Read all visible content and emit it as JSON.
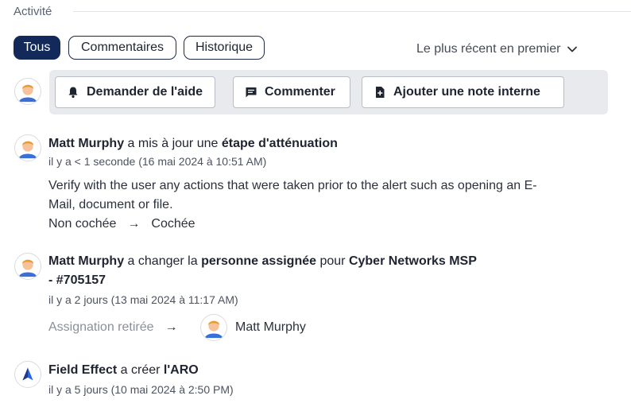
{
  "section": {
    "title": "Activité"
  },
  "filters": {
    "all": "Tous",
    "comments": "Commentaires",
    "history": "Historique"
  },
  "sort": {
    "label": "Le plus récent en premier",
    "icon": "chevron-down-icon"
  },
  "actions": {
    "help": "Demander de l'aide",
    "comment": "Commenter",
    "note": "Ajouter une note interne"
  },
  "entries": [
    {
      "actor": "Matt Murphy",
      "verb": " a mis à jour une ",
      "object": "étape d'atténuation",
      "time": "il y a < 1 seconde (16 mai 2024 à 10:51 AM)",
      "body_line1": "Verify with the user any actions that were taken prior to the alert such as opening an E-",
      "body_line2": "Mail, document or file.",
      "from": "Non cochée",
      "arrow": "→",
      "to": "Cochée"
    },
    {
      "actor": "Matt Murphy",
      "verb": " a changer la ",
      "object": "personne assignée",
      "prep": " pour ",
      "target_line1": "Cyber Networks MSP",
      "target_line2": "- #705157",
      "time": "il y a 2 jours (13 mai 2024 à 11:17 AM)",
      "from": "Assignation retirée",
      "arrow": "→",
      "to": "Matt Murphy"
    },
    {
      "actor": "Field Effect",
      "verb": " a créer ",
      "object": "l'ARO",
      "time": "il y a 5 jours (10 mai 2024 à 2:50 PM)"
    }
  ],
  "colors": {
    "primary": "#13295a",
    "brand_logo": "#2563eb"
  }
}
